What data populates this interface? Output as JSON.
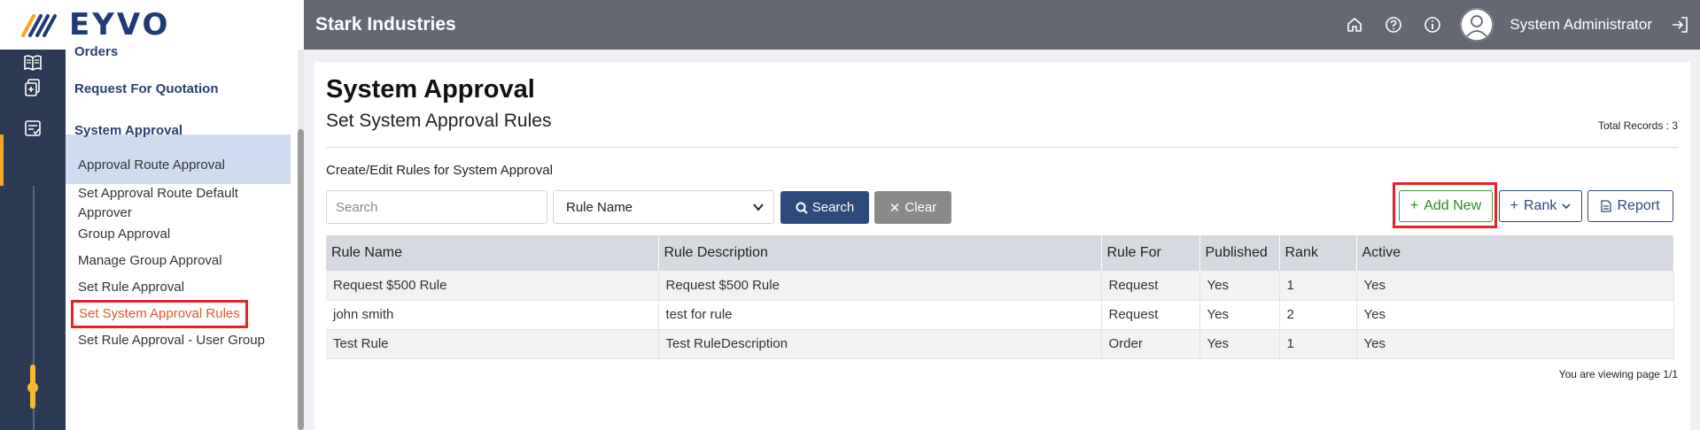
{
  "brand": {
    "name": "EYVO"
  },
  "colors": {
    "accent": "#f5a623",
    "topbar": "#646873",
    "primary": "#2c4a7a",
    "highlight": "#e4222a",
    "success": "#2a8a2a"
  },
  "sidebar": {
    "main_items": [
      {
        "label": "Orders",
        "icon": "book-icon"
      },
      {
        "label": "Request For Quotation",
        "icon": "document-plus-icon"
      },
      {
        "label": "System Approval",
        "icon": "checklist-icon",
        "active": true
      }
    ],
    "sub_items": [
      {
        "label": "Approval Route Approval"
      },
      {
        "label": "Set Approval Route Default Approver"
      },
      {
        "label": "Group Approval"
      },
      {
        "label": "Manage Group Approval"
      },
      {
        "label": "Set Rule Approval"
      },
      {
        "label": "Set System Approval Rules",
        "active": true
      },
      {
        "label": "Set Rule Approval - User Group"
      }
    ]
  },
  "header": {
    "company": "Stark Industries",
    "icons": [
      "home-icon",
      "help-icon",
      "info-icon"
    ],
    "user": "System Administrator"
  },
  "page": {
    "title": "System Approval",
    "subtitle": "Set System Approval Rules",
    "total_records": "Total Records : 3",
    "section_label": "Create/Edit Rules for System Approval"
  },
  "search": {
    "placeholder": "Search",
    "value": "",
    "field_selected": "Rule Name",
    "search_label": "Search",
    "clear_label": "Clear"
  },
  "actions": {
    "add_new": "Add New",
    "rank": "Rank",
    "report": "Report"
  },
  "table": {
    "columns": [
      "Rule Name",
      "Rule Description",
      "Rule For",
      "Published",
      "Rank",
      "Active"
    ],
    "rows": [
      [
        "Request $500 Rule",
        "Request $500 Rule",
        "Request",
        "Yes",
        "1",
        "Yes"
      ],
      [
        "john smith",
        "test for rule",
        "Request",
        "Yes",
        "2",
        "Yes"
      ],
      [
        "Test Rule",
        "Test RuleDescription",
        "Order",
        "Yes",
        "1",
        "Yes"
      ]
    ]
  },
  "paging": {
    "text": "You are viewing page 1/1"
  }
}
